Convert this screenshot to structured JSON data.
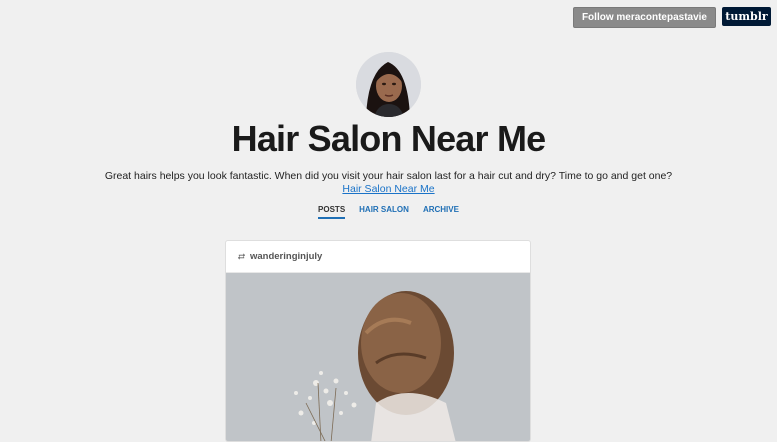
{
  "topbar": {
    "follow_label": "Follow meracontepastavie",
    "logo_text": "tumblr"
  },
  "blog": {
    "title": "Hair Salon Near Me",
    "description": "Great hairs helps you look fantastic. When did you visit your hair salon last for a hair cut and dry? Time to go and get one?",
    "description_link": "Hair Salon Near Me"
  },
  "nav": {
    "items": [
      {
        "label": "POSTS",
        "active": true
      },
      {
        "label": "HAIR SALON",
        "active": false
      },
      {
        "label": "ARCHIVE",
        "active": false
      }
    ]
  },
  "post": {
    "reblog_icon": "reblog-icon",
    "author": "wanderinginjuly"
  },
  "colors": {
    "background": "#f0f0f0",
    "link": "#1f6fb5",
    "tumblr_navy": "#001935"
  }
}
